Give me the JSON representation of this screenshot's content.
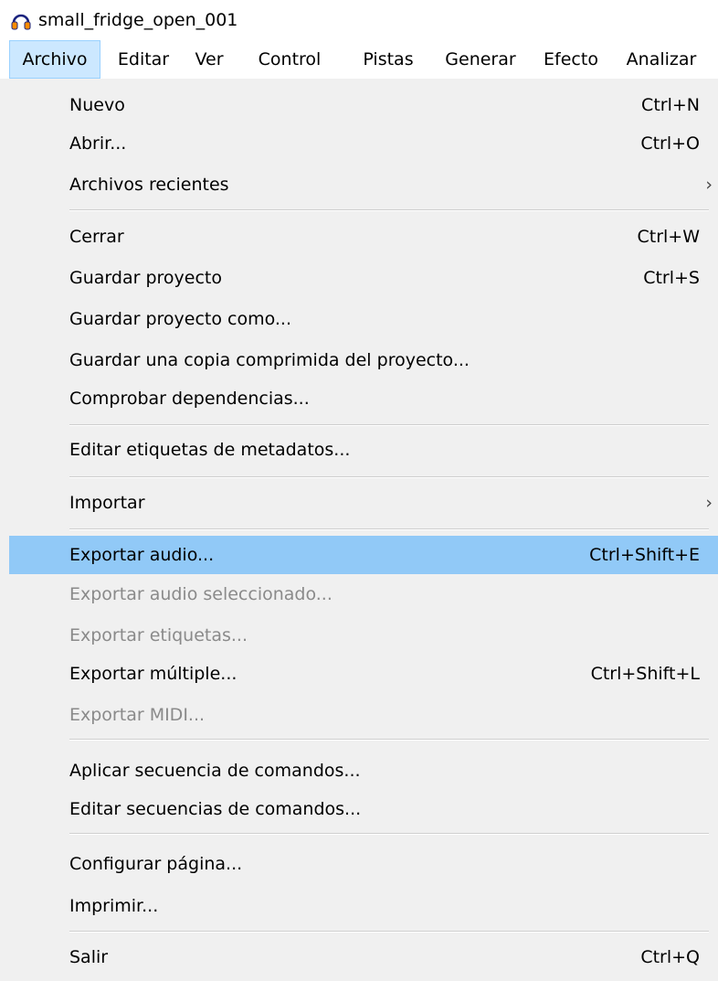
{
  "window": {
    "title": "small_fridge_open_001",
    "icon": "headphones-icon"
  },
  "menubar": {
    "items": [
      "Archivo",
      "Editar",
      "Ver",
      "Control",
      "Pistas",
      "Generar",
      "Efecto",
      "Analizar"
    ],
    "active": "Archivo"
  },
  "file_menu": {
    "items": [
      {
        "label": "Nuevo",
        "shortcut": "Ctrl+N"
      },
      {
        "label": "Abrir...",
        "shortcut": "Ctrl+O"
      },
      {
        "label": "Archivos recientes",
        "submenu_arrow": "›"
      },
      {
        "label": "Cerrar",
        "shortcut": "Ctrl+W"
      },
      {
        "label": "Guardar proyecto",
        "shortcut": "Ctrl+S"
      },
      {
        "label": "Guardar proyecto como..."
      },
      {
        "label": "Guardar una copia comprimida del proyecto..."
      },
      {
        "label": "Comprobar dependencias..."
      },
      {
        "label": "Editar etiquetas de metadatos..."
      },
      {
        "label": "Importar",
        "submenu_arrow": "›"
      },
      {
        "label": "Exportar audio...",
        "shortcut": "Ctrl+Shift+E",
        "highlighted": true
      },
      {
        "label": "Exportar audio seleccionado...",
        "disabled": true
      },
      {
        "label": "Exportar etiquetas...",
        "disabled": true
      },
      {
        "label": "Exportar múltiple...",
        "shortcut": "Ctrl+Shift+L"
      },
      {
        "label": "Exportar MIDI...",
        "disabled": true
      },
      {
        "label": "Aplicar secuencia de comandos..."
      },
      {
        "label": "Editar secuencias de comandos..."
      },
      {
        "label": "Configurar página..."
      },
      {
        "label": "Imprimir..."
      },
      {
        "label": "Salir",
        "shortcut": "Ctrl+Q"
      }
    ]
  },
  "colors": {
    "highlight": "#91c9f7",
    "active_menubar_item": "#cce8ff",
    "disabled_text": "#8a8a8a",
    "menu_background": "#f0f0f0"
  }
}
